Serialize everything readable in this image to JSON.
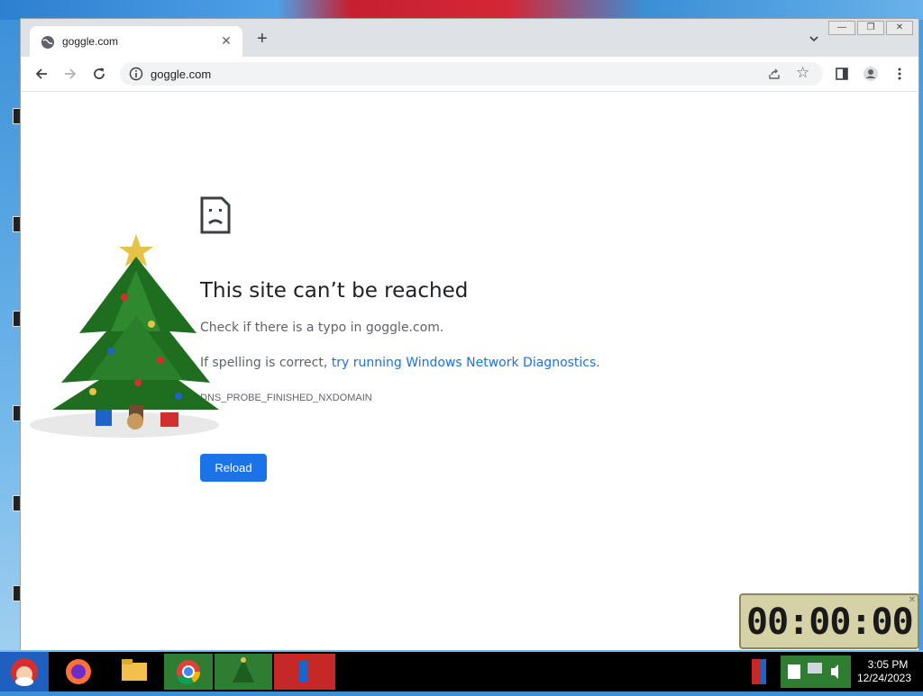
{
  "browser": {
    "tab": {
      "title": "goggle.com",
      "close": "✕"
    },
    "new_tab": "+",
    "window_buttons": {
      "minimize": "—",
      "maximize": "❐",
      "close": "✕"
    },
    "omnibox": {
      "url": "goggle.com"
    }
  },
  "error_page": {
    "title": "This site can’t be reached",
    "line1": "Check if there is a typo in goggle.com.",
    "line2_prefix": "If spelling is correct, ",
    "line2_link": "try running Windows Network Diagnostics",
    "line2_suffix": ".",
    "error_code": "DNS_PROBE_FINISHED_NXDOMAIN",
    "reload_label": "Reload"
  },
  "countdown": {
    "display": "00:00:00",
    "close": "✕"
  },
  "taskbar": {
    "time": "3:05 PM",
    "date": "12/24/2023"
  },
  "colors": {
    "accent": "#1a73e8",
    "tabstrip": "#dee1e6",
    "text_secondary": "#5f6368"
  }
}
